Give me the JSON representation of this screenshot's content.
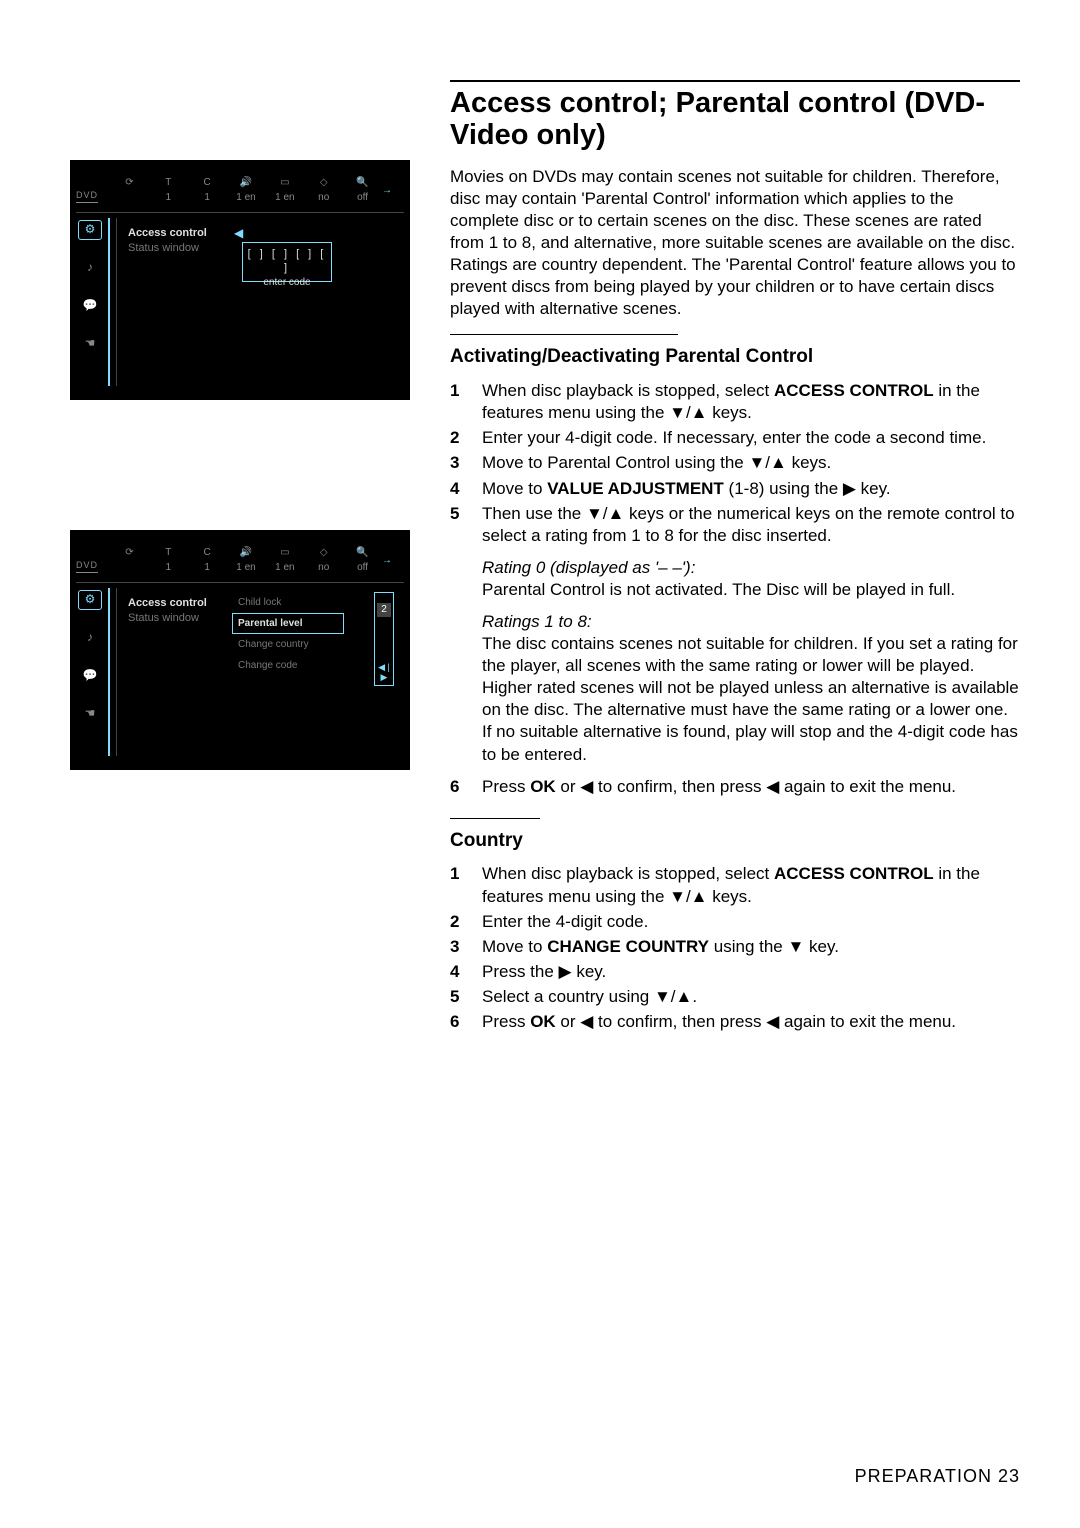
{
  "title": "Access control; Parental control (DVD-Video only)",
  "intro": "Movies on DVDs may contain scenes not suitable for children. Therefore, disc may contain 'Parental Control' information which applies to the complete disc or to certain scenes on the disc. These scenes are rated from 1 to 8, and alternative, more suitable scenes are available on the disc. Ratings are country dependent. The 'Parental Control' feature allows you to prevent discs from being played by your children or to have certain discs played with alternative scenes.",
  "sec1": {
    "heading": "Activating/Deactivating Parental Control",
    "steps": {
      "s1a": "When disc playback is stopped, select ",
      "s1b": "ACCESS CONTROL",
      "s1c": " in the features menu using the ▼/▲ keys.",
      "s2": "Enter your 4-digit code. If necessary, enter the code a second time.",
      "s3": "Move to Parental Control using the ▼/▲  keys.",
      "s4a": "Move to ",
      "s4b": "VALUE ADJUSTMENT",
      "s4c": " (1-8) using the ▶  key.",
      "s5": "Then use the ▼/▲ keys or the numerical keys on the remote control to select a rating from 1 to 8 for the disc inserted."
    },
    "rating0_h": "Rating 0 (displayed as '– –'):",
    "rating0": "Parental Control is not activated. The Disc will be played in full.",
    "rating18_h": "Ratings 1 to 8:",
    "rating18": "The disc contains scenes not suitable for children. If you set a rating for the player, all scenes with the same rating or lower will be played. Higher rated scenes will not be played unless an alternative is available on the disc. The alternative must have the same rating or a lower one. If no suitable alternative is found, play will stop and the 4-digit code has to be entered.",
    "s6a": "Press ",
    "s6b": "OK",
    "s6c": " or ◀ to confirm, then press ◀ again to exit the menu."
  },
  "sec2": {
    "heading": "Country",
    "steps": {
      "s1a": "When disc playback is stopped, select ",
      "s1b": "ACCESS CONTROL",
      "s1c": " in the features menu using the ▼/▲  keys.",
      "s2": "Enter the 4-digit code.",
      "s3a": "Move to ",
      "s3b": "CHANGE COUNTRY",
      "s3c": " using the ▼ key.",
      "s4": "Press the ▶ key.",
      "s5": "Select a country using ▼/▲.",
      "s6a": "Press ",
      "s6b": "OK",
      "s6c": " or ◀ to confirm, then press ◀ again to exit the menu."
    }
  },
  "osd_common": {
    "dvd": "DVD",
    "top_vals": [
      "1",
      "1",
      "1 en",
      "1 en",
      "no",
      "off"
    ],
    "menu1": "Access control",
    "menu2": "Status window"
  },
  "osd1": {
    "code": "[ ]  [ ]  [ ]  [ ]",
    "prompt": "enter code"
  },
  "osd2": {
    "items": [
      "Child lock",
      "Parental level",
      "Change country",
      "Change code"
    ],
    "sel": 1,
    "slider_val": "2"
  },
  "footer": {
    "prep": "PREPARATION",
    "num": "23"
  }
}
